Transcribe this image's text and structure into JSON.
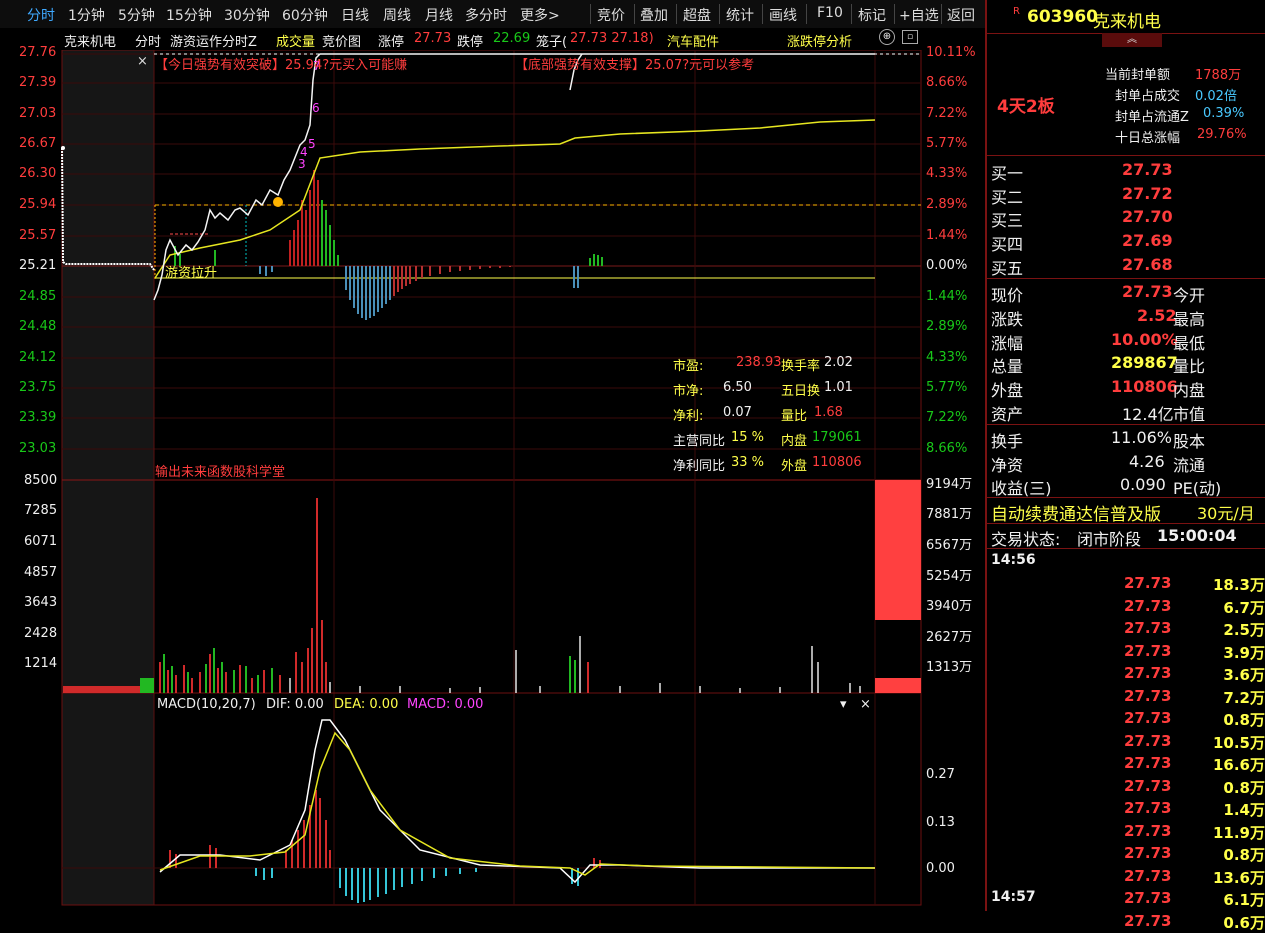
{
  "topbar": {
    "tabs": [
      "分时",
      "1分钟",
      "5分钟",
      "15分钟",
      "30分钟",
      "60分钟",
      "日线",
      "周线",
      "月线",
      "多分时",
      "更多>"
    ],
    "tools": [
      "竞价",
      "叠加",
      "超盘",
      "统计",
      "画线",
      "F10",
      "标记",
      "+自选",
      "返回"
    ]
  },
  "header": {
    "name": "克来机电",
    "mode": "分时",
    "indicator": "游资运作分时Z",
    "volume": "成交量",
    "bid_chart": "竞价图",
    "limit_up_label": "涨停",
    "limit_up": "27.73",
    "limit_down_label": "跌停",
    "limit_down": "22.69",
    "cage_label": "笼子(",
    "cage_values": "27.73  27.18)",
    "sector": "汽车配件",
    "analysis": "涨跌停分析"
  },
  "price_axis": {
    "left": [
      "27.76",
      "27.39",
      "27.03",
      "26.67",
      "26.30",
      "25.94",
      "25.57",
      "25.21",
      "24.85",
      "24.48",
      "24.12",
      "23.75",
      "23.39",
      "23.03"
    ],
    "right": [
      "10.11%",
      "8.66%",
      "7.22%",
      "5.77%",
      "4.33%",
      "2.89%",
      "1.44%",
      "0.00%",
      "1.44%",
      "2.89%",
      "4.33%",
      "5.77%",
      "7.22%",
      "8.66%"
    ]
  },
  "volume_axis": {
    "left": [
      "8500",
      "7285",
      "6071",
      "4857",
      "3643",
      "2428",
      "1214"
    ],
    "right": [
      "9194万",
      "7881万",
      "6567万",
      "5254万",
      "3940万",
      "2627万",
      "1313万"
    ]
  },
  "macd_axis": [
    "0.27",
    "0.13",
    "0.00"
  ],
  "annotations": {
    "breakout": "【今日强势有效突破】25.94?元买入可能赚",
    "support": "【底部强势有效支撑】25.07?元可以参考",
    "pull_up": "游资拉升",
    "vol_overlay": "输出未来函数股科学堂",
    "wave_labels": [
      "7",
      "6",
      "5",
      "4",
      "3"
    ]
  },
  "fundamentals": [
    {
      "label": "市盈:",
      "value": "238.93",
      "label2": "换手率",
      "value2": "2.02"
    },
    {
      "label": "市净:",
      "value": "6.50",
      "label2": "五日换",
      "value2": "1.01"
    },
    {
      "label": "净利:",
      "value": "0.07",
      "label2": "量比",
      "value2": "1.68"
    },
    {
      "label": "主营同比",
      "value": "15 %",
      "label2": "内盘",
      "value2": "179061"
    },
    {
      "label": "净利同比",
      "value": "33 %",
      "label2": "外盘",
      "value2": "110806"
    }
  ],
  "macd": {
    "title": "MACD(10,20,7)",
    "dif": "DIF: 0.00",
    "dea": "DEA: 0.00",
    "macd": "MACD: 0.00"
  },
  "right_panel": {
    "code": "603960",
    "name": "克来机电",
    "streak": "4天2板",
    "seal": [
      {
        "label": "当前封单额",
        "value": "1788万"
      },
      {
        "label": "封单占成交",
        "value": "0.02倍"
      },
      {
        "label": "封单占流通Z",
        "value": "0.39%"
      },
      {
        "label": "十日总涨幅",
        "value": "29.76%"
      }
    ],
    "bids": [
      {
        "label": "买一",
        "price": "27.73"
      },
      {
        "label": "买二",
        "price": "27.72"
      },
      {
        "label": "买三",
        "price": "27.70"
      },
      {
        "label": "买四",
        "price": "27.69"
      },
      {
        "label": "买五",
        "price": "27.68"
      }
    ],
    "quote": [
      {
        "label": "现价",
        "value": "27.73",
        "label2": "今开"
      },
      {
        "label": "涨跌",
        "value": "2.52",
        "label2": "最高"
      },
      {
        "label": "涨幅",
        "value": "10.00%",
        "label2": "最低"
      },
      {
        "label": "总量",
        "value": "289867",
        "label2": "量比"
      },
      {
        "label": "外盘",
        "value": "110806",
        "label2": "内盘"
      },
      {
        "label": "资产",
        "value": "12.4亿",
        "label2": "市值"
      }
    ],
    "quote2": [
      {
        "label": "换手",
        "value": "11.06%",
        "label2": "股本"
      },
      {
        "label": "净资",
        "value": "4.26",
        "label2": "流通"
      },
      {
        "label": "收益(三)",
        "value": "0.090",
        "label2": "PE(动)"
      }
    ],
    "ad": {
      "text": "自动续费通达信普及版",
      "price": "30元/月"
    },
    "status": {
      "label": "交易状态:",
      "value": "闭市阶段",
      "time": "15:00:04"
    },
    "ticks_time1": "14:56",
    "ticks_time2": "14:57",
    "ticks": [
      {
        "price": "27.73",
        "vol": "18.3万"
      },
      {
        "price": "27.73",
        "vol": "6.7万"
      },
      {
        "price": "27.73",
        "vol": "2.5万"
      },
      {
        "price": "27.73",
        "vol": "3.9万"
      },
      {
        "price": "27.73",
        "vol": "3.6万"
      },
      {
        "price": "27.73",
        "vol": "7.2万"
      },
      {
        "price": "27.73",
        "vol": "0.8万"
      },
      {
        "price": "27.73",
        "vol": "10.5万"
      },
      {
        "price": "27.73",
        "vol": "16.6万"
      },
      {
        "price": "27.73",
        "vol": "0.8万"
      },
      {
        "price": "27.73",
        "vol": "1.4万"
      },
      {
        "price": "27.73",
        "vol": "11.9万"
      },
      {
        "price": "27.73",
        "vol": "0.8万"
      },
      {
        "price": "27.73",
        "vol": "13.6万"
      },
      {
        "price": "27.73",
        "vol": "6.1万"
      },
      {
        "price": "27.73",
        "vol": "0.6万"
      }
    ]
  }
}
